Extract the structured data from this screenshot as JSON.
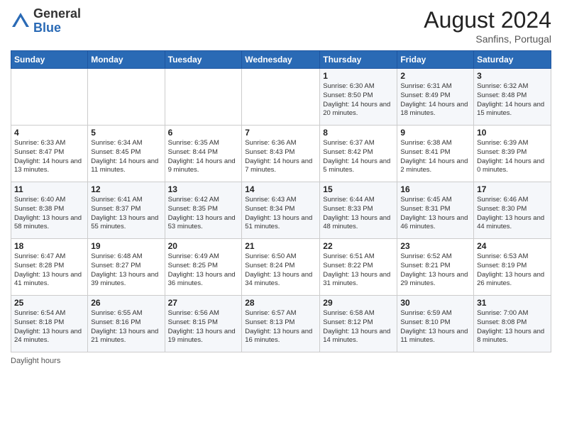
{
  "header": {
    "logo_general": "General",
    "logo_blue": "Blue",
    "month_year": "August 2024",
    "location": "Sanfins, Portugal"
  },
  "days_of_week": [
    "Sunday",
    "Monday",
    "Tuesday",
    "Wednesday",
    "Thursday",
    "Friday",
    "Saturday"
  ],
  "footer": {
    "daylight_hours": "Daylight hours"
  },
  "weeks": [
    [
      {
        "day": "",
        "sunrise": "",
        "sunset": "",
        "daylight": ""
      },
      {
        "day": "",
        "sunrise": "",
        "sunset": "",
        "daylight": ""
      },
      {
        "day": "",
        "sunrise": "",
        "sunset": "",
        "daylight": ""
      },
      {
        "day": "",
        "sunrise": "",
        "sunset": "",
        "daylight": ""
      },
      {
        "day": "1",
        "sunrise": "Sunrise: 6:30 AM",
        "sunset": "Sunset: 8:50 PM",
        "daylight": "Daylight: 14 hours and 20 minutes."
      },
      {
        "day": "2",
        "sunrise": "Sunrise: 6:31 AM",
        "sunset": "Sunset: 8:49 PM",
        "daylight": "Daylight: 14 hours and 18 minutes."
      },
      {
        "day": "3",
        "sunrise": "Sunrise: 6:32 AM",
        "sunset": "Sunset: 8:48 PM",
        "daylight": "Daylight: 14 hours and 15 minutes."
      }
    ],
    [
      {
        "day": "4",
        "sunrise": "Sunrise: 6:33 AM",
        "sunset": "Sunset: 8:47 PM",
        "daylight": "Daylight: 14 hours and 13 minutes."
      },
      {
        "day": "5",
        "sunrise": "Sunrise: 6:34 AM",
        "sunset": "Sunset: 8:45 PM",
        "daylight": "Daylight: 14 hours and 11 minutes."
      },
      {
        "day": "6",
        "sunrise": "Sunrise: 6:35 AM",
        "sunset": "Sunset: 8:44 PM",
        "daylight": "Daylight: 14 hours and 9 minutes."
      },
      {
        "day": "7",
        "sunrise": "Sunrise: 6:36 AM",
        "sunset": "Sunset: 8:43 PM",
        "daylight": "Daylight: 14 hours and 7 minutes."
      },
      {
        "day": "8",
        "sunrise": "Sunrise: 6:37 AM",
        "sunset": "Sunset: 8:42 PM",
        "daylight": "Daylight: 14 hours and 5 minutes."
      },
      {
        "day": "9",
        "sunrise": "Sunrise: 6:38 AM",
        "sunset": "Sunset: 8:41 PM",
        "daylight": "Daylight: 14 hours and 2 minutes."
      },
      {
        "day": "10",
        "sunrise": "Sunrise: 6:39 AM",
        "sunset": "Sunset: 8:39 PM",
        "daylight": "Daylight: 14 hours and 0 minutes."
      }
    ],
    [
      {
        "day": "11",
        "sunrise": "Sunrise: 6:40 AM",
        "sunset": "Sunset: 8:38 PM",
        "daylight": "Daylight: 13 hours and 58 minutes."
      },
      {
        "day": "12",
        "sunrise": "Sunrise: 6:41 AM",
        "sunset": "Sunset: 8:37 PM",
        "daylight": "Daylight: 13 hours and 55 minutes."
      },
      {
        "day": "13",
        "sunrise": "Sunrise: 6:42 AM",
        "sunset": "Sunset: 8:35 PM",
        "daylight": "Daylight: 13 hours and 53 minutes."
      },
      {
        "day": "14",
        "sunrise": "Sunrise: 6:43 AM",
        "sunset": "Sunset: 8:34 PM",
        "daylight": "Daylight: 13 hours and 51 minutes."
      },
      {
        "day": "15",
        "sunrise": "Sunrise: 6:44 AM",
        "sunset": "Sunset: 8:33 PM",
        "daylight": "Daylight: 13 hours and 48 minutes."
      },
      {
        "day": "16",
        "sunrise": "Sunrise: 6:45 AM",
        "sunset": "Sunset: 8:31 PM",
        "daylight": "Daylight: 13 hours and 46 minutes."
      },
      {
        "day": "17",
        "sunrise": "Sunrise: 6:46 AM",
        "sunset": "Sunset: 8:30 PM",
        "daylight": "Daylight: 13 hours and 44 minutes."
      }
    ],
    [
      {
        "day": "18",
        "sunrise": "Sunrise: 6:47 AM",
        "sunset": "Sunset: 8:28 PM",
        "daylight": "Daylight: 13 hours and 41 minutes."
      },
      {
        "day": "19",
        "sunrise": "Sunrise: 6:48 AM",
        "sunset": "Sunset: 8:27 PM",
        "daylight": "Daylight: 13 hours and 39 minutes."
      },
      {
        "day": "20",
        "sunrise": "Sunrise: 6:49 AM",
        "sunset": "Sunset: 8:25 PM",
        "daylight": "Daylight: 13 hours and 36 minutes."
      },
      {
        "day": "21",
        "sunrise": "Sunrise: 6:50 AM",
        "sunset": "Sunset: 8:24 PM",
        "daylight": "Daylight: 13 hours and 34 minutes."
      },
      {
        "day": "22",
        "sunrise": "Sunrise: 6:51 AM",
        "sunset": "Sunset: 8:22 PM",
        "daylight": "Daylight: 13 hours and 31 minutes."
      },
      {
        "day": "23",
        "sunrise": "Sunrise: 6:52 AM",
        "sunset": "Sunset: 8:21 PM",
        "daylight": "Daylight: 13 hours and 29 minutes."
      },
      {
        "day": "24",
        "sunrise": "Sunrise: 6:53 AM",
        "sunset": "Sunset: 8:19 PM",
        "daylight": "Daylight: 13 hours and 26 minutes."
      }
    ],
    [
      {
        "day": "25",
        "sunrise": "Sunrise: 6:54 AM",
        "sunset": "Sunset: 8:18 PM",
        "daylight": "Daylight: 13 hours and 24 minutes."
      },
      {
        "day": "26",
        "sunrise": "Sunrise: 6:55 AM",
        "sunset": "Sunset: 8:16 PM",
        "daylight": "Daylight: 13 hours and 21 minutes."
      },
      {
        "day": "27",
        "sunrise": "Sunrise: 6:56 AM",
        "sunset": "Sunset: 8:15 PM",
        "daylight": "Daylight: 13 hours and 19 minutes."
      },
      {
        "day": "28",
        "sunrise": "Sunrise: 6:57 AM",
        "sunset": "Sunset: 8:13 PM",
        "daylight": "Daylight: 13 hours and 16 minutes."
      },
      {
        "day": "29",
        "sunrise": "Sunrise: 6:58 AM",
        "sunset": "Sunset: 8:12 PM",
        "daylight": "Daylight: 13 hours and 14 minutes."
      },
      {
        "day": "30",
        "sunrise": "Sunrise: 6:59 AM",
        "sunset": "Sunset: 8:10 PM",
        "daylight": "Daylight: 13 hours and 11 minutes."
      },
      {
        "day": "31",
        "sunrise": "Sunrise: 7:00 AM",
        "sunset": "Sunset: 8:08 PM",
        "daylight": "Daylight: 13 hours and 8 minutes."
      }
    ]
  ]
}
